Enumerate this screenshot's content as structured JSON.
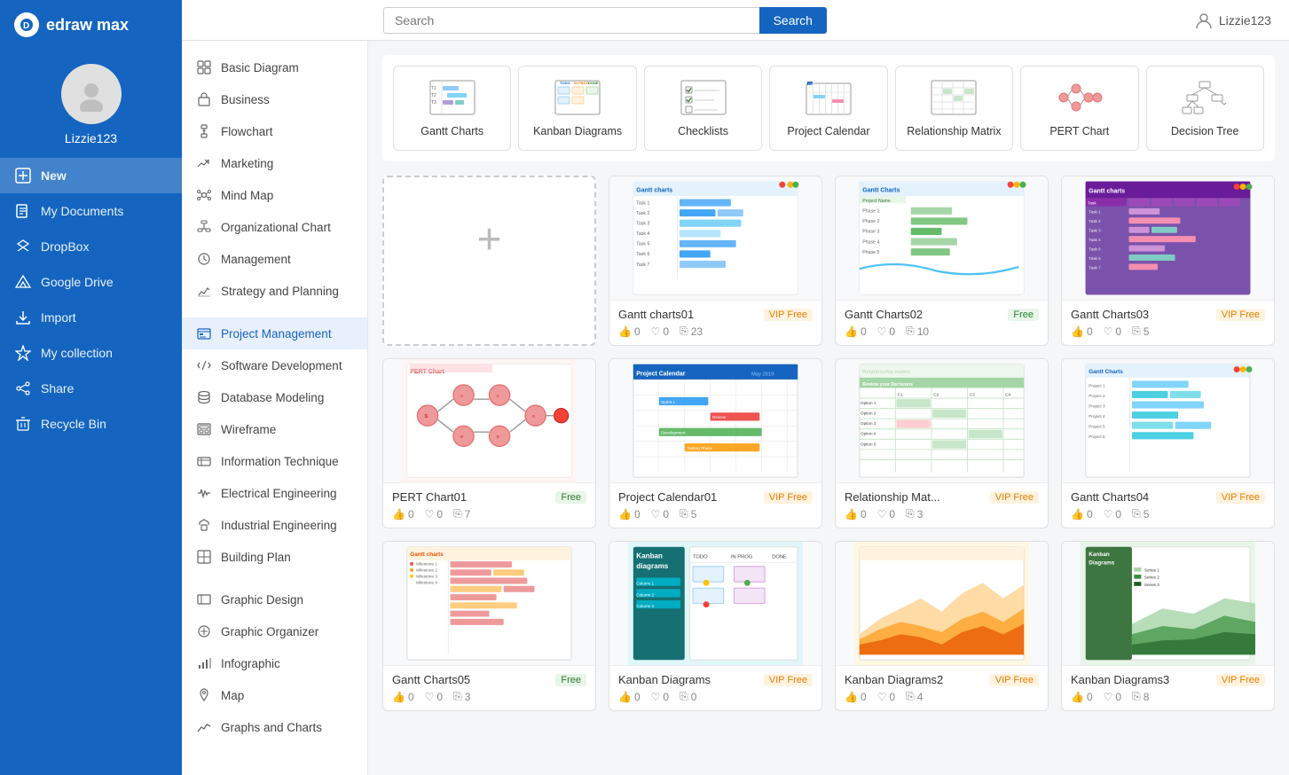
{
  "app": {
    "name": "edraw max",
    "logo_letter": "D"
  },
  "user": {
    "name": "Lizzie123"
  },
  "header": {
    "search_placeholder": "Search",
    "search_button": "Search"
  },
  "sidebar_nav": [
    {
      "id": "new",
      "label": "New",
      "icon": "plus-square",
      "active": true
    },
    {
      "id": "my-documents",
      "label": "My Documents",
      "icon": "file",
      "active": false
    },
    {
      "id": "dropbox",
      "label": "DropBox",
      "icon": "dropbox",
      "active": false
    },
    {
      "id": "google-drive",
      "label": "Google Drive",
      "icon": "google-drive",
      "active": false
    },
    {
      "id": "import",
      "label": "Import",
      "icon": "import",
      "active": false
    },
    {
      "id": "my-collection",
      "label": "My collection",
      "icon": "star",
      "active": false
    },
    {
      "id": "share",
      "label": "Share",
      "icon": "share",
      "active": false
    },
    {
      "id": "recycle-bin",
      "label": "Recycle Bin",
      "icon": "trash",
      "active": false
    }
  ],
  "categories": [
    {
      "id": "basic-diagram",
      "label": "Basic Diagram",
      "active": false
    },
    {
      "id": "business",
      "label": "Business",
      "active": false
    },
    {
      "id": "flowchart",
      "label": "Flowchart",
      "active": false
    },
    {
      "id": "marketing",
      "label": "Marketing",
      "active": false
    },
    {
      "id": "mind-map",
      "label": "Mind Map",
      "active": false
    },
    {
      "id": "organizational-chart",
      "label": "Organizational Chart",
      "active": false
    },
    {
      "id": "management",
      "label": "Management",
      "active": false
    },
    {
      "id": "strategy-and-planning",
      "label": "Strategy and Planning",
      "active": false
    },
    {
      "id": "project-management",
      "label": "Project Management",
      "active": true
    },
    {
      "id": "software-development",
      "label": "Software Development",
      "active": false
    },
    {
      "id": "database-modeling",
      "label": "Database Modeling",
      "active": false
    },
    {
      "id": "wireframe",
      "label": "Wireframe",
      "active": false
    },
    {
      "id": "information-technique",
      "label": "Information Technique",
      "active": false
    },
    {
      "id": "electrical-engineering",
      "label": "Electrical Engineering",
      "active": false
    },
    {
      "id": "industrial-engineering",
      "label": "Industrial Engineering",
      "active": false
    },
    {
      "id": "building-plan",
      "label": "Building Plan",
      "active": false
    },
    {
      "id": "graphic-design",
      "label": "Graphic Design",
      "active": false
    },
    {
      "id": "graphic-organizer",
      "label": "Graphic Organizer",
      "active": false
    },
    {
      "id": "infographic",
      "label": "Infographic",
      "active": false
    },
    {
      "id": "map",
      "label": "Map",
      "active": false
    },
    {
      "id": "graphs-and-charts",
      "label": "Graphs and Charts",
      "active": false
    }
  ],
  "type_cards": [
    {
      "id": "gantt-charts",
      "label": "Gantt Charts"
    },
    {
      "id": "kanban-diagrams",
      "label": "Kanban Diagrams"
    },
    {
      "id": "checklists",
      "label": "Checklists"
    },
    {
      "id": "project-calendar",
      "label": "Project Calendar"
    },
    {
      "id": "relationship-matrix",
      "label": "Relationship Matrix"
    },
    {
      "id": "pert-chart",
      "label": "PERT Chart"
    },
    {
      "id": "decision-tree",
      "label": "Decision Tree"
    }
  ],
  "templates": [
    {
      "id": "new",
      "is_new": true,
      "label": "New"
    },
    {
      "id": "gantt-charts01",
      "title": "Gantt charts01",
      "badge": "VIP Free",
      "badge_type": "vip",
      "likes": 0,
      "favorites": 0,
      "copies": 23,
      "color": "#3b7dd8",
      "thumb_type": "gantt1"
    },
    {
      "id": "gantt-charts02",
      "title": "Gantt Charts02",
      "badge": "Free",
      "badge_type": "free",
      "likes": 0,
      "favorites": 0,
      "copies": 10,
      "color": "#4caf8a",
      "thumb_type": "gantt2"
    },
    {
      "id": "gantt-charts03",
      "title": "Gantt Charts03",
      "badge": "VIP Free",
      "badge_type": "vip",
      "likes": 0,
      "favorites": 0,
      "copies": 5,
      "color": "#7b52ab",
      "thumb_type": "gantt3"
    },
    {
      "id": "pert-chart01",
      "title": "PERT Chart01",
      "badge": "Free",
      "badge_type": "free",
      "likes": 0,
      "favorites": 0,
      "copies": 7,
      "color": "#e57373",
      "thumb_type": "pert"
    },
    {
      "id": "project-calendar01",
      "title": "Project Calendar01",
      "badge": "VIP Free",
      "badge_type": "vip",
      "likes": 0,
      "favorites": 0,
      "copies": 5,
      "color": "#1565c0",
      "thumb_type": "calendar"
    },
    {
      "id": "relationship-mat",
      "title": "Relationship Mat...",
      "badge": "VIP Free",
      "badge_type": "vip",
      "likes": 0,
      "favorites": 0,
      "copies": 3,
      "color": "#66bb6a",
      "thumb_type": "relationship"
    },
    {
      "id": "gantt-charts04",
      "title": "Gantt Charts04",
      "badge": "VIP Free",
      "badge_type": "vip",
      "likes": 0,
      "favorites": 0,
      "copies": 5,
      "color": "#4fc3f7",
      "thumb_type": "gantt4"
    },
    {
      "id": "gantt-charts05",
      "title": "Gantt Charts05",
      "badge": "Free",
      "badge_type": "free",
      "likes": 0,
      "favorites": 0,
      "copies": 3,
      "color": "#ef9a9a",
      "thumb_type": "gantt5"
    },
    {
      "id": "kanban-diagrams",
      "title": "Kanban Diagrams",
      "badge": "VIP Free",
      "badge_type": "vip",
      "likes": 0,
      "favorites": 0,
      "copies": 0,
      "color": "#26c6da",
      "thumb_type": "kanban1"
    },
    {
      "id": "kanban-diagrams2",
      "title": "Kanban Diagrams2",
      "badge": "VIP Free",
      "badge_type": "vip",
      "likes": 0,
      "favorites": 0,
      "copies": 4,
      "color": "#ff7043",
      "thumb_type": "kanban2"
    },
    {
      "id": "kanban-diagrams3",
      "title": "Kanban Diagrams3",
      "badge": "VIP Free",
      "badge_type": "vip",
      "likes": 0,
      "favorites": 0,
      "copies": 8,
      "color": "#66bb6a",
      "thumb_type": "kanban3"
    }
  ]
}
